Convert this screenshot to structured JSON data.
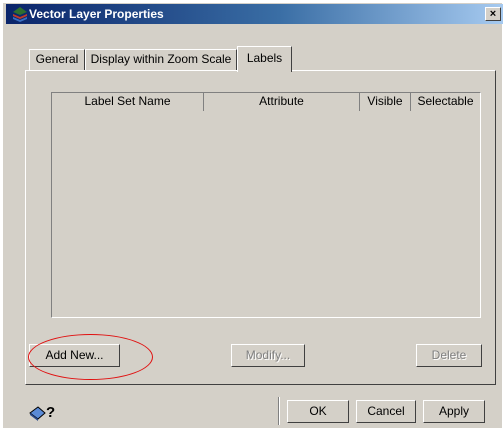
{
  "window": {
    "title": "Vector Layer Properties",
    "close_glyph": "×"
  },
  "tabs": [
    {
      "label": "General"
    },
    {
      "label": "Display within Zoom Scale"
    },
    {
      "label": "Labels",
      "active": true
    }
  ],
  "list": {
    "columns": [
      "Label Set Name",
      "Attribute",
      "Visible",
      "Selectable"
    ],
    "rows": []
  },
  "buttons": {
    "add_new": "Add New...",
    "modify": "Modify...",
    "delete": "Delete",
    "ok": "OK",
    "cancel": "Cancel",
    "apply": "Apply"
  },
  "icons": {
    "title": "layers-app-icon",
    "help": "help-icon"
  },
  "colors": {
    "face": "#d4d0c8",
    "title_start": "#0a246a",
    "title_end": "#a6caf0",
    "annotation": "#e01010"
  }
}
